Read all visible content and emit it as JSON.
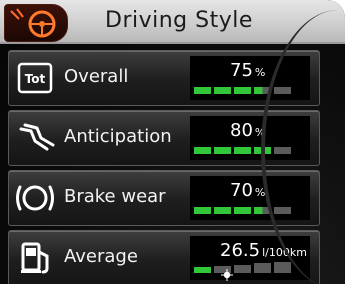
{
  "header": {
    "title": "Driving Style",
    "icon": "steering-wheel-icon"
  },
  "rows": [
    {
      "label": "Overall",
      "icon": "tot-badge-icon",
      "icon_text": "Tot",
      "value": "75",
      "unit": "%",
      "segments_total": 5,
      "segments_on": 3.5
    },
    {
      "label": "Anticipation",
      "icon": "anticipation-icon",
      "value": "80",
      "unit": "%",
      "segments_total": 5,
      "segments_on": 4
    },
    {
      "label": "Brake wear",
      "icon": "brake-warning-icon",
      "value": "70",
      "unit": "%",
      "segments_total": 5,
      "segments_on": 3.5
    },
    {
      "label": "Average",
      "icon": "fuel-pump-icon",
      "value": "26.5",
      "unit": "l/100km",
      "segments_total": 5,
      "segments_on": 1
    }
  ],
  "colors": {
    "bar_on": "#32c63a",
    "bar_off": "#5b5b5b"
  }
}
